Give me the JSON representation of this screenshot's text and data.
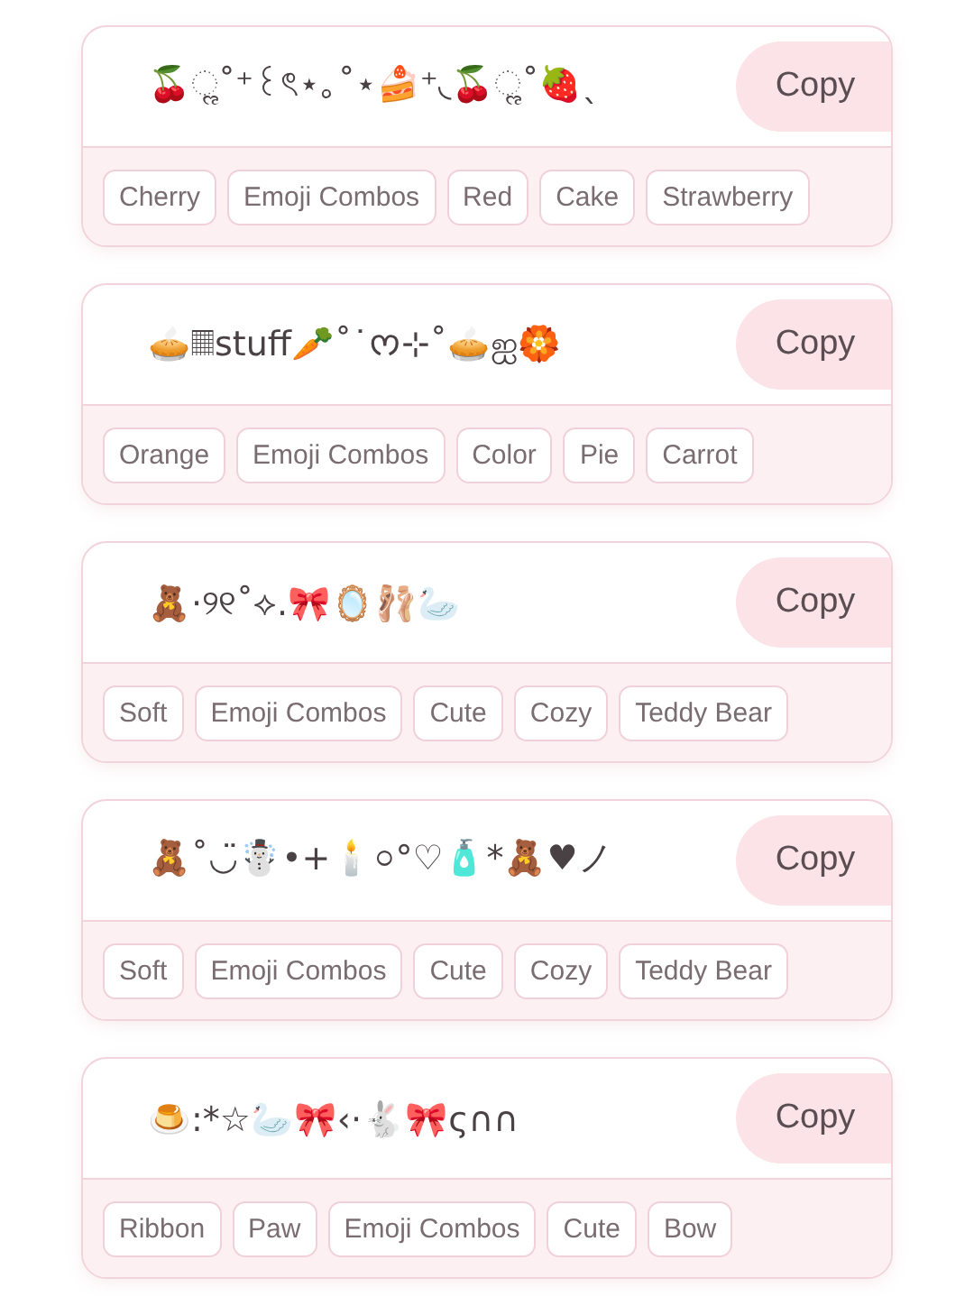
{
  "cards": [
    {
      "combo": "🍒ૢ˚⁺꒰ৎ⋆｡˚⋆🍰⁺◟🍒ૢ˚🍓ˎ",
      "button": "Copy",
      "tags": [
        "Cherry",
        "Emoji Combos",
        "Red",
        "Cake",
        "Strawberry"
      ]
    },
    {
      "combo": "🥧𝄜stuff🥕˚˙ᰔ⊹˚🥧ஐ🏵️",
      "button": "Copy",
      "tags": [
        "Orange",
        "Emoji Combos",
        "Color",
        "Pie",
        "Carrot"
      ]
    },
    {
      "combo": "🧸·୨୧˚⟡.🎀🪞🩰🦢",
      "button": "Copy",
      "tags": [
        "Soft",
        "Emoji Combos",
        "Cute",
        "Cozy",
        "Teddy Bear"
      ]
    },
    {
      "combo": "🧸˚◡̈☃️•+🕯️০°♡🧴*🧸♥ノ",
      "button": "Copy",
      "tags": [
        "Soft",
        "Emoji Combos",
        "Cute",
        "Cozy",
        "Teddy Bear"
      ]
    },
    {
      "combo": "🍮:*☆🦢🎀‹·🐇🎀ς∩∩",
      "button": "Copy",
      "tags": [
        "Ribbon",
        "Paw",
        "Emoji Combos",
        "Cute",
        "Bow"
      ]
    }
  ]
}
